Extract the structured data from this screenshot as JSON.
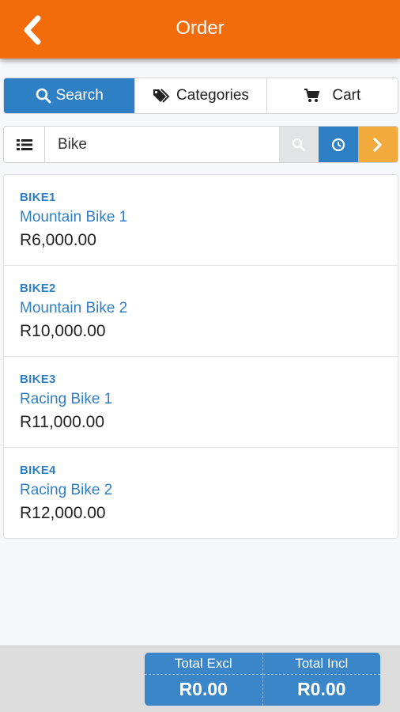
{
  "header": {
    "title": "Order",
    "back_icon": "chevron-left-icon"
  },
  "tabs": [
    {
      "label": "Search",
      "icon": "search-icon",
      "active": true
    },
    {
      "label": "Categories",
      "icon": "tags-icon",
      "active": false
    },
    {
      "label": "Cart",
      "icon": "cart-icon",
      "active": false
    }
  ],
  "search": {
    "value": "Bike",
    "placeholder": ""
  },
  "products": [
    {
      "code": "BIKE1",
      "name": "Mountain Bike 1",
      "price": "R6,000.00"
    },
    {
      "code": "BIKE2",
      "name": "Mountain Bike 2",
      "price": "R10,000.00"
    },
    {
      "code": "BIKE3",
      "name": "Racing Bike 1",
      "price": "R11,000.00"
    },
    {
      "code": "BIKE4",
      "name": "Racing Bike 2",
      "price": "R12,000.00"
    }
  ],
  "totals": {
    "excl_label": "Total Excl",
    "excl_value": "R0.00",
    "incl_label": "Total Incl",
    "incl_value": "R0.00"
  },
  "colors": {
    "brand": "#f36c0b",
    "accent": "#2f7fc4",
    "next": "#f1aa3b"
  }
}
